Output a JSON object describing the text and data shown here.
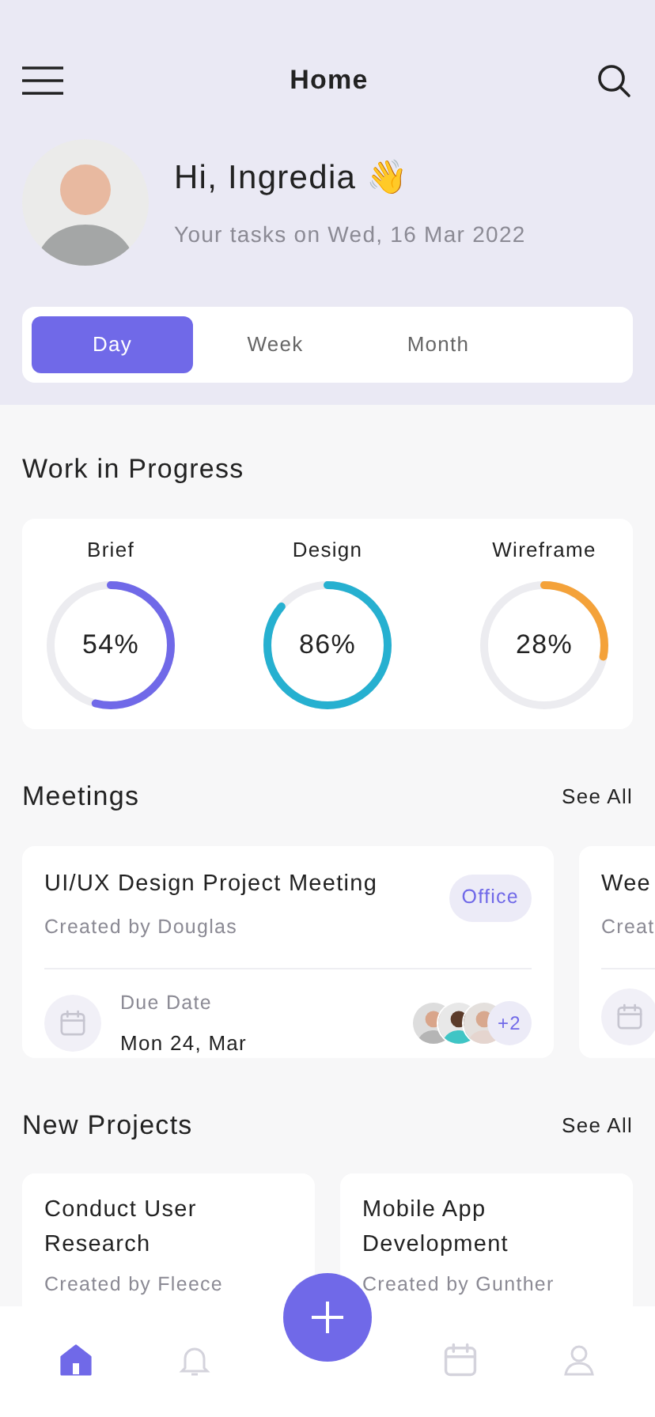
{
  "header": {
    "title": "Home"
  },
  "greeting": {
    "title": "Hi, Ingredia 👋",
    "subtitle": "Your tasks on Wed, 16 Mar 2022"
  },
  "tabs": [
    {
      "label": "Day",
      "selected": true
    },
    {
      "label": "Week",
      "selected": false
    },
    {
      "label": "Month",
      "selected": false
    }
  ],
  "work_in_progress": {
    "title": "Work in Progress",
    "items": [
      {
        "label": "Brief",
        "reading": "54%",
        "level": 0.54,
        "color": "#7069e8"
      },
      {
        "label": "Design",
        "reading": "86%",
        "level": 0.86,
        "color": "#26b0d0"
      },
      {
        "label": "Wireframe",
        "reading": "28%",
        "level": 0.28,
        "color": "#f4a23a"
      }
    ]
  },
  "meetings": {
    "title": "Meetings",
    "link": "See All",
    "items": [
      {
        "title": "UI/UX Design Project Meeting",
        "creator": "Created by Douglas",
        "tag": "Office",
        "due_label": "Due Date",
        "due_date": "Mon 24, Mar",
        "extra_count": "+2"
      },
      {
        "title": "Wee",
        "creator": "Creat"
      }
    ]
  },
  "new_projects": {
    "title": "New Projects",
    "link": "See All",
    "items": [
      {
        "title": "Conduct User Research",
        "creator": "Created by Fleece"
      },
      {
        "title": "Mobile App Development",
        "creator": "Created by Gunther"
      }
    ]
  },
  "bottom_nav": [
    {
      "kind": "home",
      "selected": true
    },
    {
      "kind": "bell",
      "selected": false
    },
    {
      "kind": "calendar",
      "selected": false
    },
    {
      "kind": "user",
      "selected": false
    }
  ]
}
